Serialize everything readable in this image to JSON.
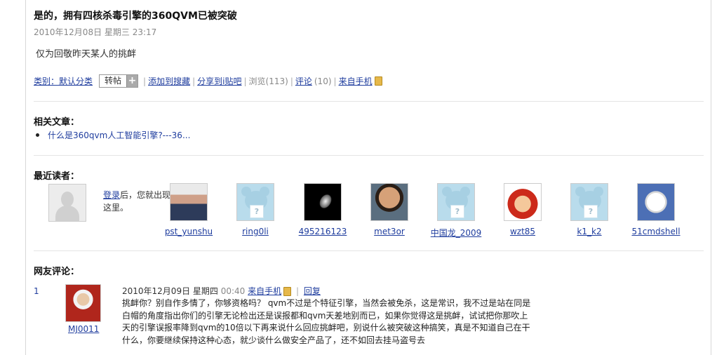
{
  "post": {
    "title": "是的，拥有四核杀毒引擎的360QVM已被突破",
    "date": "2010年12月08日 星期三 23:17",
    "body": "仅为回敬昨天某人的挑衅"
  },
  "meta": {
    "category": "类别：默认分类",
    "zhuantie": "转帖",
    "plus": "+",
    "sep": "|",
    "add_search": "添加到搜藏",
    "share_tieba": "分享到i贴吧",
    "views": "浏览(113)",
    "comments_label": "评论",
    "comments_count": "(10)",
    "from_mobile": "来自手机"
  },
  "related": {
    "heading": "相关文章：",
    "items": [
      "什么是360qvm人工智能引擎?---36..."
    ]
  },
  "readers": {
    "heading": "最近读者：",
    "login_link": "登录",
    "login_rest": "后，您就出现在这里。",
    "list": [
      {
        "name": "pst_yunshu",
        "avatar": "photo"
      },
      {
        "name": "ring0li",
        "avatar": "default"
      },
      {
        "name": "495216123",
        "avatar": "dark"
      },
      {
        "name": "met3or",
        "avatar": "face"
      },
      {
        "name": "中国龙_2009",
        "avatar": "default"
      },
      {
        "name": "wzt85",
        "avatar": "cartoon"
      },
      {
        "name": "k1_k2",
        "avatar": "default"
      },
      {
        "name": "51cmdshell",
        "avatar": "dog"
      }
    ]
  },
  "comments": {
    "heading": "网友评论：",
    "items": [
      {
        "num": "1",
        "user": "MJ0011",
        "date": "2010年12月09日 星期四",
        "time": "00:40",
        "from": "来自手机",
        "reply": "回复",
        "lines": [
          "挑衅你？别自作多情了，你够资格吗？ qvm不过是个特征引擎，当然会被免杀，这是常识，我不过是站在同是",
          "白帽的角度指出你们的引擎无论检出还是误报都和qvm天差地别而已，如果你觉得这是挑衅，试试把你那吹上",
          "天的引擎误报率降到qvm的10倍以下再来说什么回应挑衅吧，别说什么被突破这种搞笑，真是不知道自己在干",
          "什么，你要继续保持这种心态，就少谈什么做安全产品了，还不如回去挂马盗号去"
        ]
      }
    ]
  }
}
